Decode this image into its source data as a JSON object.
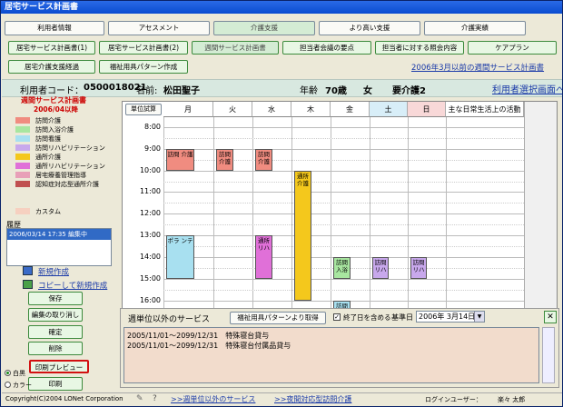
{
  "window": {
    "title": "居宅サービス計画書"
  },
  "top_tabs": [
    "利用者情報",
    "アセスメント",
    "介護支援",
    "より高い支援",
    "介護実績"
  ],
  "sub_tabs_row1": [
    "居宅サービス計画書(1)",
    "居宅サービス計画書(2)",
    "週間サービス計画書",
    "担当者会議の要点",
    "担当者に対する照会内容",
    "ケアプラン"
  ],
  "sub_tabs_row2": [
    "居宅介護支援経過",
    "福祉用具パターン作成"
  ],
  "old_plan_link": "2006年3月以前の週間サービス計画書",
  "user": {
    "code_label": "利用者コード：",
    "code": "0500018021",
    "name_label": "名前:",
    "name": "松田聖子",
    "age_label": "年齢",
    "age": "70歳",
    "sex": "女",
    "care_level": "要介護2",
    "select_link": "利用者選択画面へ"
  },
  "legend": {
    "title": "週間サービス計画書",
    "date": "2006/04以降",
    "items": [
      {
        "label": "訪問介護",
        "color": "#f08c80"
      },
      {
        "label": "訪問入浴介護",
        "color": "#a8e6a0"
      },
      {
        "label": "訪問看護",
        "color": "#a8e0f0"
      },
      {
        "label": "訪問リハビリテーション",
        "color": "#c8a8ec"
      },
      {
        "label": "通所介護",
        "color": "#f4c81c"
      },
      {
        "label": "通所リハビリテーション",
        "color": "#e070d8"
      },
      {
        "label": "居宅療養管理指導",
        "color": "#e8a0b8"
      },
      {
        "label": "認知症対応型通所介護",
        "color": "#c05050"
      }
    ],
    "custom": {
      "label": "カスタム",
      "color": "#f6d0c0"
    }
  },
  "history": {
    "label": "履歴",
    "entry": "2006/03/14 17:35 編集中"
  },
  "actions": {
    "new": "新規作成",
    "copy_new": "コピーして新規作成",
    "save": "保存",
    "undo": "編集の取り消し",
    "confirm": "確定",
    "delete": "削除",
    "print_preview": "印刷プレビュー",
    "print": "印刷"
  },
  "print_mode": {
    "mono": "白黒",
    "color": "カラー"
  },
  "schedule": {
    "unit_calc": "単位試算",
    "days": [
      "月",
      "火",
      "水",
      "木",
      "金",
      "土",
      "日"
    ],
    "activity_header": "主な日常生活上の活動",
    "times": [
      "8:00",
      "9:00",
      "10:00",
      "11:00",
      "12:00",
      "13:00",
      "14:00",
      "15:00",
      "16:00"
    ]
  },
  "blocks": [
    {
      "day": 0,
      "start": 9.0,
      "end": 10.0,
      "text": "訪問 介護",
      "color": "#f08c80"
    },
    {
      "day": 1,
      "start": 9.0,
      "end": 10.0,
      "text": "訪問 介護",
      "color": "#f08c80"
    },
    {
      "day": 2,
      "start": 9.0,
      "end": 10.0,
      "text": "訪問 介護",
      "color": "#f08c80"
    },
    {
      "day": 0,
      "start": 13.0,
      "end": 15.0,
      "text": "ポラ ンテ",
      "color": "#a8e0f0"
    },
    {
      "day": 2,
      "start": 13.0,
      "end": 15.0,
      "text": "通所 リハ",
      "color": "#e070d8"
    },
    {
      "day": 3,
      "start": 10.0,
      "end": 16.0,
      "text": "通所 介護",
      "color": "#f4c81c"
    },
    {
      "day": 4,
      "start": 14.0,
      "end": 15.0,
      "text": "訪問 入浴",
      "color": "#a8e6a0"
    },
    {
      "day": 5,
      "start": 14.0,
      "end": 15.0,
      "text": "訪問 リハ",
      "color": "#c8a8ec"
    },
    {
      "day": 6,
      "start": 14.0,
      "end": 15.0,
      "text": "訪問 リハ",
      "color": "#c8a8ec"
    },
    {
      "day": 4,
      "start": 16.0,
      "end": 16.5,
      "text": "訪問",
      "color": "#a8e0f0"
    }
  ],
  "weekly_panel": {
    "title": "週単位以外のサービス",
    "fetch_button": "福祉用具パターンより取得",
    "include_label": "終了日を含める",
    "include_checked": true,
    "base_date_label": "基準日",
    "base_date": "2006年 3月14日",
    "lines": [
      "2005/11/01～2099/12/31　特殊寝台貸与",
      "2005/11/01～2099/12/31　特殊寝台付属品貸与"
    ]
  },
  "status": {
    "copyright": "Copyright(C)2004 LONet Corporation",
    "link1": ">>週単位以外のサービス",
    "link2": ">>夜間対応型訪問介護",
    "login_label": "ログインユーザー：",
    "login_user": "楽々 太郎"
  }
}
